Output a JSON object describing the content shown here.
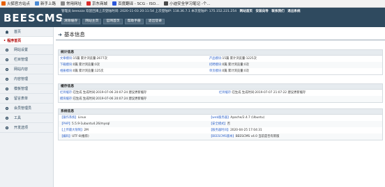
{
  "bookmarks": [
    {
      "label": "火狐官方站点",
      "color": "#e66000"
    },
    {
      "label": "新手上路",
      "color": "#4a8ad4"
    },
    {
      "label": "常用网址",
      "color": "#888888"
    },
    {
      "label": "京东商城",
      "color": "#d92b2b"
    },
    {
      "label": "百度翻译 - SCG - ISO...",
      "color": "#2b56d9"
    },
    {
      "label": "小迪安全学习笔记 -个...",
      "color": "#4a4a4a"
    }
  ],
  "header": {
    "logo": "BEESCMS",
    "info_text": "管理员 beeszzx 欢迎回来上次登陆时间: 2020-11-03 20:11:54 上次登陆IP: 118.36.7.1 本次登陆IP: 175.152.221.254",
    "links": [
      "网站首页",
      "安装向导",
      "联系我们",
      "退出系统"
    ],
    "nav_buttons": [
      "清除缓存",
      "网站主页",
      "官网首页",
      "帮助手册",
      "退出登录"
    ]
  },
  "sidebar": {
    "items": [
      {
        "label": "首页",
        "icon": "home-icon"
      },
      {
        "label": "程序首页",
        "active": true
      },
      {
        "label": "网站设置",
        "icon": "gear-icon"
      },
      {
        "label": "栏目管理",
        "icon": "gear-icon"
      },
      {
        "label": "网站内容",
        "icon": "gear-icon"
      },
      {
        "label": "内容管理",
        "icon": "gear-icon"
      },
      {
        "label": "模板管理",
        "icon": "gear-icon"
      },
      {
        "label": "留言表单",
        "icon": "gear-icon"
      },
      {
        "label": "会员管理员",
        "icon": "gear-icon"
      },
      {
        "label": "工具",
        "icon": "gear-icon"
      },
      {
        "label": "开发选项",
        "icon": "gear-icon"
      }
    ]
  },
  "main": {
    "title": "基本信息",
    "stats": {
      "heading": "统计信息",
      "rows": [
        {
          "left_label": "文章模块",
          "left_value": ":15篇 累计浏览量:2677次",
          "right_label": "产品模块",
          "right_value": ":15篇 累计浏览量:1225次"
        },
        {
          "left_label": "下载模块",
          "left_value": ":0篇 累计浏览量:0次",
          "right_label": "招聘模块",
          "right_value": ":0篇 累计浏览量:0次"
        },
        {
          "left_label": "相册模块",
          "left_value": ":0篇 累计浏览量:125次",
          "right_label": "单页模块",
          "right_value": ":0篇 累计浏览量:0次"
        }
      ]
    },
    "cache": {
      "heading": "缓存信息",
      "rows": [
        {
          "left_label": "栏目缓存",
          "left_value": ":已生成 生成时间:2019-07-06 20:07:24 建议更新缓存",
          "right_label": "栏目缓存",
          "right_value": ":已生成 生成时间:2019-07-07 21:07:22 建议更新缓存"
        },
        {
          "left_label": "模块缓存",
          "left_value": ":已生成 生成时间:2019-07-06 20:07:24 建议更新缓存",
          "right_label": "",
          "right_value": ""
        }
      ]
    },
    "system": {
      "heading": "系统信息",
      "rows": [
        {
          "left_label": "【操作系统】",
          "left_value": "Linux",
          "right_label": "【web服务器】",
          "right_value": "Apache/2.4.7 (Ubuntu)"
        },
        {
          "left_label": "【PHP】",
          "left_value": "5.5.9-1ubuntu4.26/mysql",
          "right_label": "【安全模式】",
          "right_value": "否"
        },
        {
          "left_label": "【上传最大限制】",
          "left_value": "2M",
          "right_label": "【服务器时间】",
          "right_value": "2020-04-25 17:04:31"
        },
        {
          "left_label": "【编码】",
          "left_value": "UTF-8(推荐)",
          "right_label": "【BEESCMS版本】",
          "right_value": "BEESCMS v4.0 当前是否有新版"
        }
      ]
    }
  }
}
